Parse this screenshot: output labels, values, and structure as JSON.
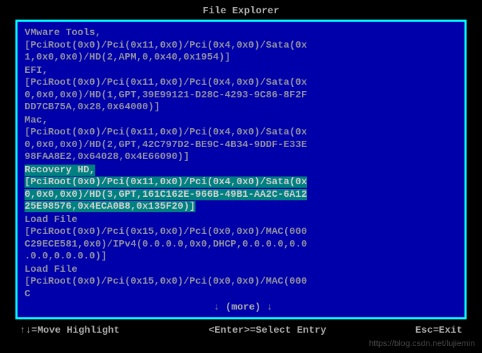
{
  "title": "File Explorer",
  "entries": [
    {
      "name": "VMware Tools,",
      "path": "[PciRoot(0x0)/Pci(0x11,0x0)/Pci(0x4,0x0)/Sata(0x1,0x0,0x0)/HD(2,APM,0,0x40,0x1954)]",
      "selected": false
    },
    {
      "name": "EFI,",
      "path": "[PciRoot(0x0)/Pci(0x11,0x0)/Pci(0x4,0x0)/Sata(0x0,0x0,0x0)/HD(1,GPT,39E99121-D28C-4293-9C86-8F2FDD7CB75A,0x28,0x64000)]",
      "selected": false
    },
    {
      "name": "Mac,",
      "path": "[PciRoot(0x0)/Pci(0x11,0x0)/Pci(0x4,0x0)/Sata(0x0,0x0,0x0)/HD(2,GPT,42C797D2-BE9C-4B34-9DDF-E33E98FAA8E2,0x64028,0x4E66090)]",
      "selected": false
    },
    {
      "name": "Recovery HD,",
      "path": "[PciRoot(0x0)/Pci(0x11,0x0)/Pci(0x4,0x0)/Sata(0x0,0x0,0x0)/HD(3,GPT,161C162E-966B-49B1-AA2C-6A1225E98576,0x4ECA0B8,0x135F20)]",
      "selected": true
    },
    {
      "name": "Load File",
      "path": "[PciRoot(0x0)/Pci(0x15,0x0)/Pci(0x0,0x0)/MAC(000C29ECE581,0x0)/IPv4(0.0.0.0,0x0,DHCP,0.0.0.0,0.0.0.0,0.0.0.0)]",
      "selected": false
    },
    {
      "name": "Load File",
      "path": "[PciRoot(0x0)/Pci(0x15,0x0)/Pci(0x0,0x0)/MAC(000C",
      "selected": false
    }
  ],
  "more_label": "(more)",
  "footer": {
    "move": "↑↓=Move Highlight",
    "select": "<Enter>=Select Entry",
    "exit": "Esc=Exit"
  },
  "watermark": "https://blog.csdn.net/lujiemin"
}
